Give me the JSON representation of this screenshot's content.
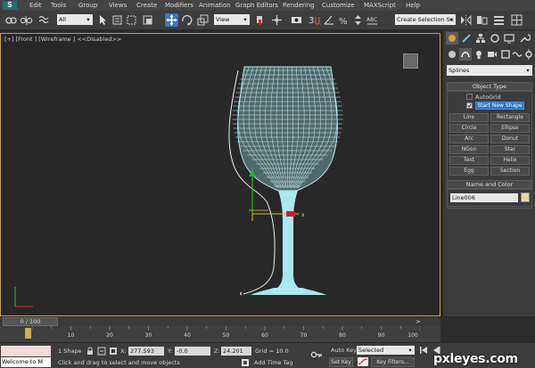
{
  "app": {
    "logo_letter": "S"
  },
  "menu": [
    "Edit",
    "Tools",
    "Group",
    "Views",
    "Create",
    "Modifiers",
    "Animation",
    "Graph Editors",
    "Rendering",
    "Customize",
    "MAXScript",
    "Help"
  ],
  "toolbar": {
    "selection_filter": "All",
    "reference_coord": "View",
    "named_selection_placeholder": "Create Selection Se"
  },
  "viewport": {
    "label": "[+] [Front ] [Wireframe ] <<Disabled>>",
    "object_color": "#a8e8ef",
    "border_color": "#c8a23a",
    "gizmo_x_label": "x"
  },
  "command_panel": {
    "category": "Splines",
    "object_type_title": "Object Type",
    "autogrid_label": "AutoGrid",
    "start_new_shape_label": "Start New Shape",
    "start_new_shape_checked": true,
    "buttons": [
      [
        "Line",
        "Rectangle"
      ],
      [
        "Circle",
        "Ellipse"
      ],
      [
        "Arc",
        "Donut"
      ],
      [
        "NGon",
        "Star"
      ],
      [
        "Text",
        "Helix"
      ],
      [
        "Egg",
        "Section"
      ]
    ],
    "name_color_title": "Name and Color",
    "object_name": "Line006",
    "object_color": "#e8d9a0"
  },
  "time_slider": {
    "label": "0 / 100",
    "current_frame": 0,
    "total_frames": 100
  },
  "track_bar": {
    "ticks": [
      "10",
      "20",
      "30",
      "40",
      "50",
      "60",
      "70",
      "80",
      "90",
      "100"
    ]
  },
  "status": {
    "maxscript_text": "Welcome to M",
    "selection_count": "1 Shape",
    "prompt": "Click and drag to select and move objects",
    "x_label": "X:",
    "x_value": "277.593",
    "y_label": "Y:",
    "y_value": "-0.0",
    "z_label": "Z:",
    "z_value": "24.201",
    "grid": "Grid = 10.0",
    "add_time_tag": "Add Time Tag",
    "auto_key": "Auto Key",
    "set_key": "Set Key",
    "key_mode": "Selected",
    "key_filters": "Key Filters..."
  },
  "watermark": "pxleyes.com"
}
